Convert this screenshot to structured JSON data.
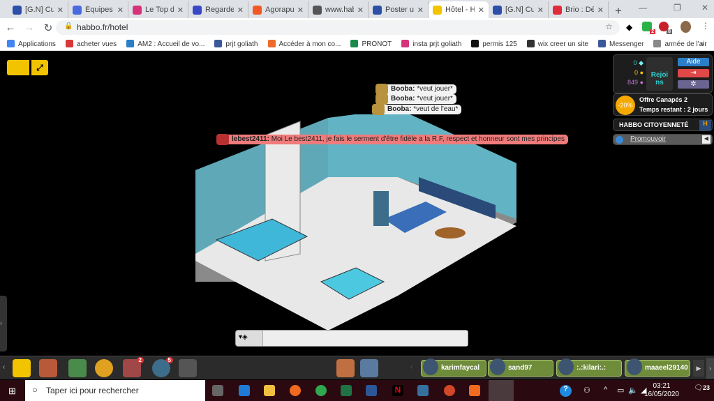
{
  "browser": {
    "tabs": [
      {
        "label": "[G.N] Cur",
        "color": "#2c4fa8"
      },
      {
        "label": "Équipes -",
        "color": "#4a6be0"
      },
      {
        "label": "Le Top du",
        "color": "#d6337a"
      },
      {
        "label": "Regarder",
        "color": "#3a48c8"
      },
      {
        "label": "Agorapul",
        "color": "#f05a22"
      },
      {
        "label": "www.hab",
        "color": "#555555"
      },
      {
        "label": "Poster un",
        "color": "#2c4fa8"
      },
      {
        "label": "Hôtel - H",
        "color": "#f2c400",
        "active": true
      },
      {
        "label": "[G.N] Cur",
        "color": "#2c4fa8"
      },
      {
        "label": "Brio : Déf",
        "color": "#e02b3a"
      }
    ],
    "url": "habbo.fr/hotel",
    "extension_badges": [
      "2",
      "8"
    ],
    "bookmarks": [
      {
        "label": "Applications",
        "color": "#4285f4"
      },
      {
        "label": "acheter vues",
        "color": "#d93838"
      },
      {
        "label": "AM2 : Accueil de vo...",
        "color": "#2a7fc8"
      },
      {
        "label": "prjt goliath",
        "color": "#3b5998"
      },
      {
        "label": "Accéder à mon co...",
        "color": "#f06a2a"
      },
      {
        "label": "PRONOT",
        "color": "#1a8a4a"
      },
      {
        "label": "insta prjt goliath",
        "color": "#d6337a"
      },
      {
        "label": "permis 125",
        "color": "#111111"
      },
      {
        "label": "wix creer un site",
        "color": "#333333"
      },
      {
        "label": "Messenger",
        "color": "#3b5998"
      },
      {
        "label": "armée de l'air",
        "color": "#888888"
      }
    ]
  },
  "hotel": {
    "chat": [
      {
        "user": "Booba:",
        "text": "*veut jouer*"
      },
      {
        "user": "Booba:",
        "text": "*veut jouer*"
      },
      {
        "user": "Booba:",
        "text": "*veut de l'eau*"
      },
      {
        "user": "lebest2411:",
        "text": "Moi Le best2411, je fais le serment d'être fidèle a la R.F, respect et honneur sont mes principes"
      }
    ],
    "currency": {
      "diamonds": "0",
      "credits": "0",
      "duckets": "849"
    },
    "join_label": "Rejoi ns",
    "help_label": "Aide",
    "offer": {
      "badge": "-20%",
      "title": "Offre Canapés 2",
      "time": "Temps restant : 2 jours"
    },
    "group_title": "HABBO CITOYENNETÉ",
    "promote_label": "Promouvoir",
    "toolbar_badges": [
      "2",
      "5"
    ],
    "friends": [
      "karimfaycal",
      "sand97",
      ":.:kilari:.:",
      "maaeel29140"
    ]
  },
  "taskbar": {
    "search_placeholder": "Taper ici pour rechercher",
    "time": "03:21",
    "date": "16/05/2020",
    "notifications": "23"
  }
}
